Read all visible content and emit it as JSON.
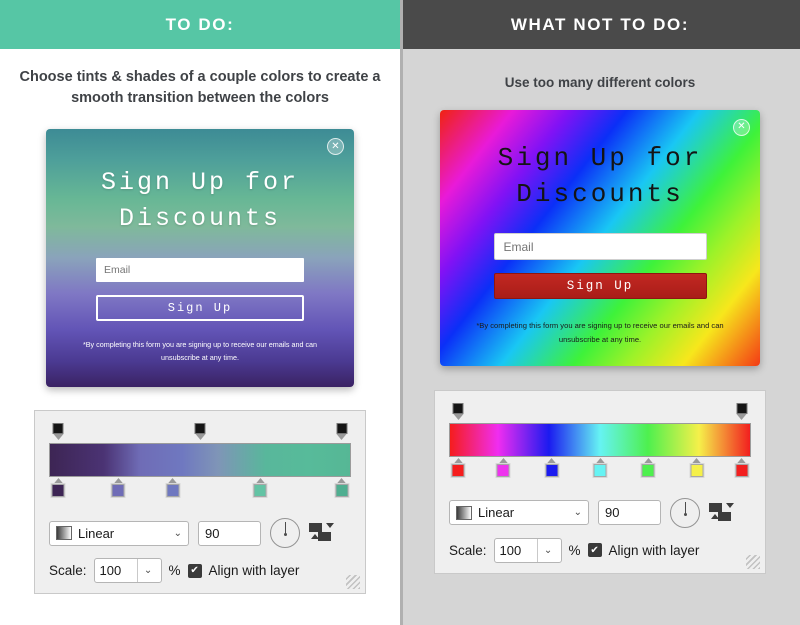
{
  "left": {
    "banner_title": "TO DO:",
    "caption": "Choose tints & shades of a couple colors to create a smooth transition between the colors",
    "card": {
      "close_icon": "close-icon",
      "title": "Sign Up for Discounts",
      "email_placeholder": "Email",
      "email_value": "",
      "signup_label": "Sign Up",
      "fine_print": "*By completing this form you are signing up to receive our emails and can unsubscribe at any time."
    },
    "editor": {
      "gradient_type": "Linear",
      "angle": "90",
      "scale_label": "Scale:",
      "scale_value": "100",
      "percent": "%",
      "align_label": "Align with layer",
      "align_checked": true,
      "check_glyph": "✔",
      "chevron_glyph": "⌄",
      "opacity_stops": [
        {
          "position": 3,
          "color": "#151515"
        },
        {
          "position": 50,
          "color": "#151515"
        },
        {
          "position": 97,
          "color": "#151515"
        }
      ],
      "color_stops": [
        {
          "position": 3,
          "color": "#3d2554"
        },
        {
          "position": 23,
          "color": "#6f6cb6"
        },
        {
          "position": 41,
          "color": "#6f78c0"
        },
        {
          "position": 70,
          "color": "#63c3a4"
        },
        {
          "position": 97,
          "color": "#4fae90"
        }
      ],
      "bar_gradient": "#3d2554 → #6f6cb6 → #7f95b7 → #56b795"
    }
  },
  "right": {
    "banner_title": "WHAT NOT TO DO:",
    "caption": "Use too many different colors",
    "card": {
      "close_icon": "close-icon",
      "title": "Sign Up for Discounts",
      "email_placeholder": "Email",
      "email_value": "",
      "signup_label": "Sign Up",
      "fine_print": "*By completing this form you are signing up to receive our emails and can unsubscribe at any time."
    },
    "editor": {
      "gradient_type": "Linear",
      "angle": "90",
      "scale_label": "Scale:",
      "scale_value": "100",
      "percent": "%",
      "align_label": "Align with layer",
      "align_checked": true,
      "check_glyph": "✔",
      "chevron_glyph": "⌄",
      "opacity_stops": [
        {
          "position": 3,
          "color": "#151515"
        },
        {
          "position": 97,
          "color": "#151515"
        }
      ],
      "color_stops": [
        {
          "position": 3,
          "color": "#f51d1d"
        },
        {
          "position": 18,
          "color": "#ee33ee"
        },
        {
          "position": 34,
          "color": "#1b1bf0"
        },
        {
          "position": 50,
          "color": "#66f3f3"
        },
        {
          "position": 66,
          "color": "#4ef04e"
        },
        {
          "position": 82,
          "color": "#f5f04a"
        },
        {
          "position": 97,
          "color": "#f21f1f"
        }
      ],
      "bar_gradient": "#f51d1d → #f02df0 → #1b1bf0 → #66f3f3 → #4ef04e → #f5f04a → #f21f1f"
    }
  },
  "colors": {
    "todo_banner": "#56c6a5",
    "not_banner": "#4a4a4a",
    "right_bg": "#d5d5d5",
    "divider": "#b0b0b0",
    "editor_bg": "#efefef",
    "text": "#3f4246",
    "signup_red": "#b4211c"
  }
}
